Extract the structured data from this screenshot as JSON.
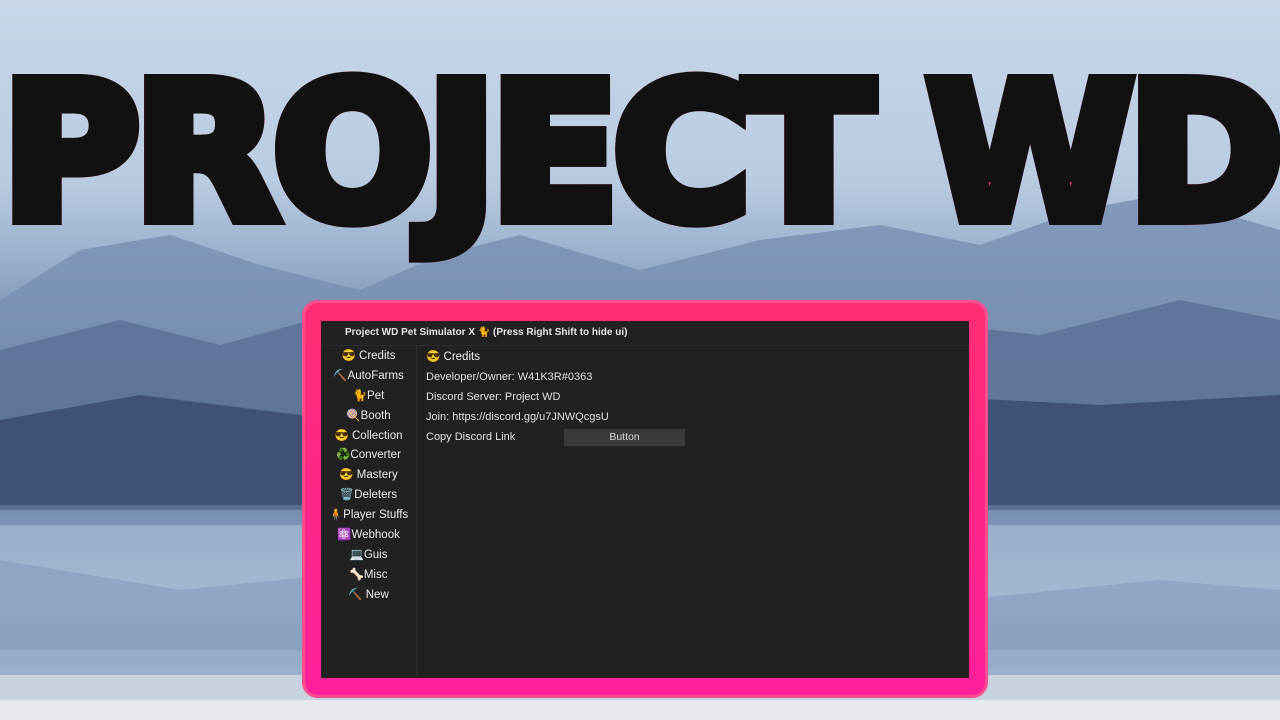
{
  "banner": {
    "title": "PROJECT WD"
  },
  "window": {
    "title": "Project WD Pet Simulator X 🐈 (Press Right Shift to hide ui)"
  },
  "sidebar": {
    "items": [
      {
        "label": "😎 Credits"
      },
      {
        "label": "⛏️AutoFarms"
      },
      {
        "label": "🐈Pet"
      },
      {
        "label": "🍭Booth"
      },
      {
        "label": "😎 Collection"
      },
      {
        "label": "♻️Converter"
      },
      {
        "label": "😎 Mastery"
      },
      {
        "label": "🗑️Deleters"
      },
      {
        "label": "🧍Player Stuffs"
      },
      {
        "label": "⚛️Webhook"
      },
      {
        "label": "💻Guis"
      },
      {
        "label": "🦴Misc"
      },
      {
        "label": "⛏️ New"
      }
    ]
  },
  "content": {
    "heading": "😎 Credits",
    "developer": "Developer/Owner: W41K3R#0363",
    "server": "Discord Server: Project WD",
    "join": "Join: https://discord.gg/u7JNWQcgsU",
    "copy_label": "Copy Discord Link",
    "button_label": "Button"
  }
}
